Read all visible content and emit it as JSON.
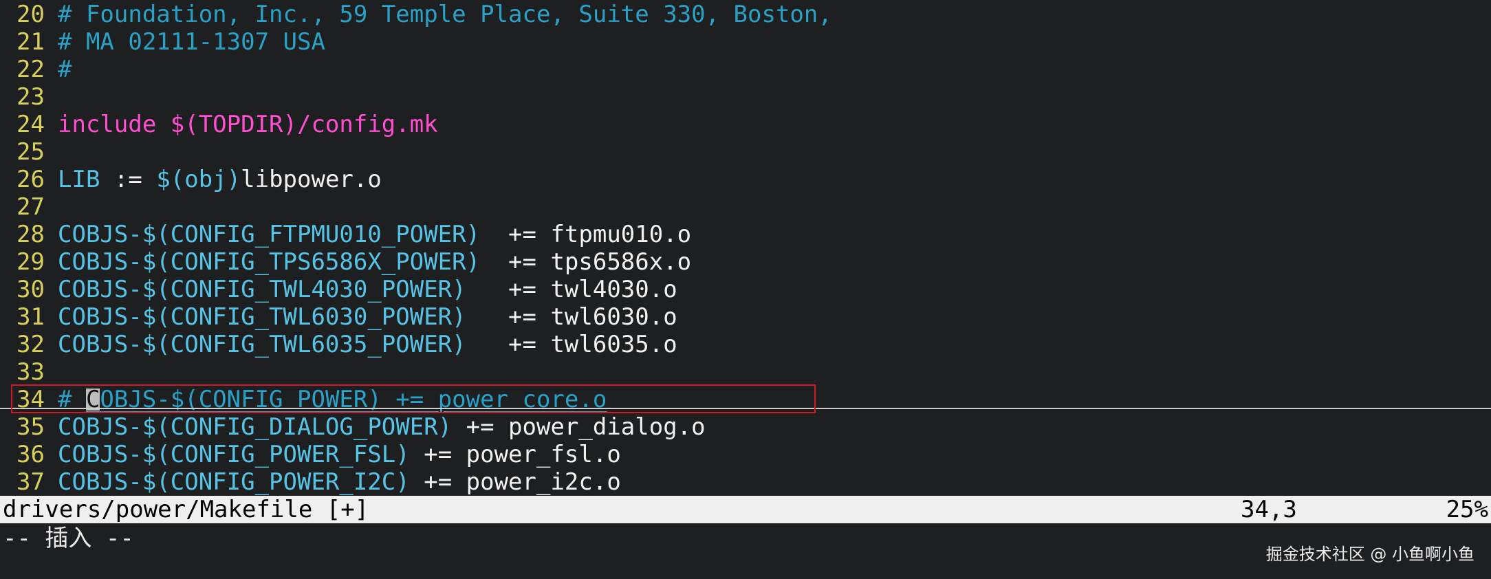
{
  "editor": {
    "lines": [
      {
        "num": "20",
        "tokens": [
          {
            "text": "# Foundation, Inc., 59 Temple Place, Suite 330, Boston,",
            "cls": "tok-comment"
          }
        ]
      },
      {
        "num": "21",
        "tokens": [
          {
            "text": "# MA 02111-1307 USA",
            "cls": "tok-comment"
          }
        ]
      },
      {
        "num": "22",
        "tokens": [
          {
            "text": "#",
            "cls": "tok-comment"
          }
        ]
      },
      {
        "num": "23",
        "tokens": []
      },
      {
        "num": "24",
        "tokens": [
          {
            "text": "include $(TOPDIR)/config.mk",
            "cls": "tok-magenta"
          }
        ]
      },
      {
        "num": "25",
        "tokens": []
      },
      {
        "num": "26",
        "tokens": [
          {
            "text": "LIB",
            "cls": "tok-cyan"
          },
          {
            "text": " := ",
            "cls": "tok-white"
          },
          {
            "text": "$(obj)",
            "cls": "tok-cyan"
          },
          {
            "text": "libpower.o",
            "cls": "tok-white"
          }
        ]
      },
      {
        "num": "27",
        "tokens": []
      },
      {
        "num": "28",
        "tokens": [
          {
            "text": "COBJS-$(CONFIG_FTPMU010_POWER)",
            "cls": "tok-cyan"
          },
          {
            "text": "  += ftpmu010.o",
            "cls": "tok-white"
          }
        ]
      },
      {
        "num": "29",
        "tokens": [
          {
            "text": "COBJS-$(CONFIG_TPS6586X_POWER)",
            "cls": "tok-cyan"
          },
          {
            "text": "  += tps6586x.o",
            "cls": "tok-white"
          }
        ]
      },
      {
        "num": "30",
        "tokens": [
          {
            "text": "COBJS-$(CONFIG_TWL4030_POWER)",
            "cls": "tok-cyan"
          },
          {
            "text": "   += twl4030.o",
            "cls": "tok-white"
          }
        ]
      },
      {
        "num": "31",
        "tokens": [
          {
            "text": "COBJS-$(CONFIG_TWL6030_POWER)",
            "cls": "tok-cyan"
          },
          {
            "text": "   += twl6030.o",
            "cls": "tok-white"
          }
        ]
      },
      {
        "num": "32",
        "tokens": [
          {
            "text": "COBJS-$(CONFIG_TWL6035_POWER)",
            "cls": "tok-cyan"
          },
          {
            "text": "   += twl6035.o",
            "cls": "tok-white"
          }
        ]
      },
      {
        "num": "33",
        "tokens": []
      },
      {
        "num": "34",
        "tokens": [
          {
            "text": "# ",
            "cls": "tok-comment"
          },
          {
            "text": " OBJS-$(CONFIG_POWER) += power_core.o",
            "cls": "tok-comment tok-under"
          }
        ]
      },
      {
        "num": "35",
        "tokens": [
          {
            "text": "COBJS-$(CONFIG_DIALOG_POWER)",
            "cls": "tok-cyan"
          },
          {
            "text": " += power_dialog.o",
            "cls": "tok-white"
          }
        ]
      },
      {
        "num": "36",
        "tokens": [
          {
            "text": "COBJS-$(CONFIG_POWER_FSL)",
            "cls": "tok-cyan"
          },
          {
            "text": " += power_fsl.o",
            "cls": "tok-white"
          }
        ]
      },
      {
        "num": "37",
        "tokens": [
          {
            "text": "COBJS-$(CONFIG_POWER_I2C)",
            "cls": "tok-cyan"
          },
          {
            "text": " += power_i2c.o",
            "cls": "tok-white"
          }
        ]
      }
    ],
    "cursor_char": "C"
  },
  "statusbar": {
    "file": "drivers/power/Makefile [+]",
    "position": "34,3",
    "percent": "25%"
  },
  "mode": "-- 插入 --",
  "watermark": "掘金技术社区 @ 小鱼啊小鱼",
  "colors": {
    "background": "#1d1f21",
    "line_number": "#d8d05a",
    "identifier": "#56c4e6",
    "comment": "#2aa1c7",
    "include": "#ff4fd0",
    "highlight_box": "#d01b25"
  }
}
